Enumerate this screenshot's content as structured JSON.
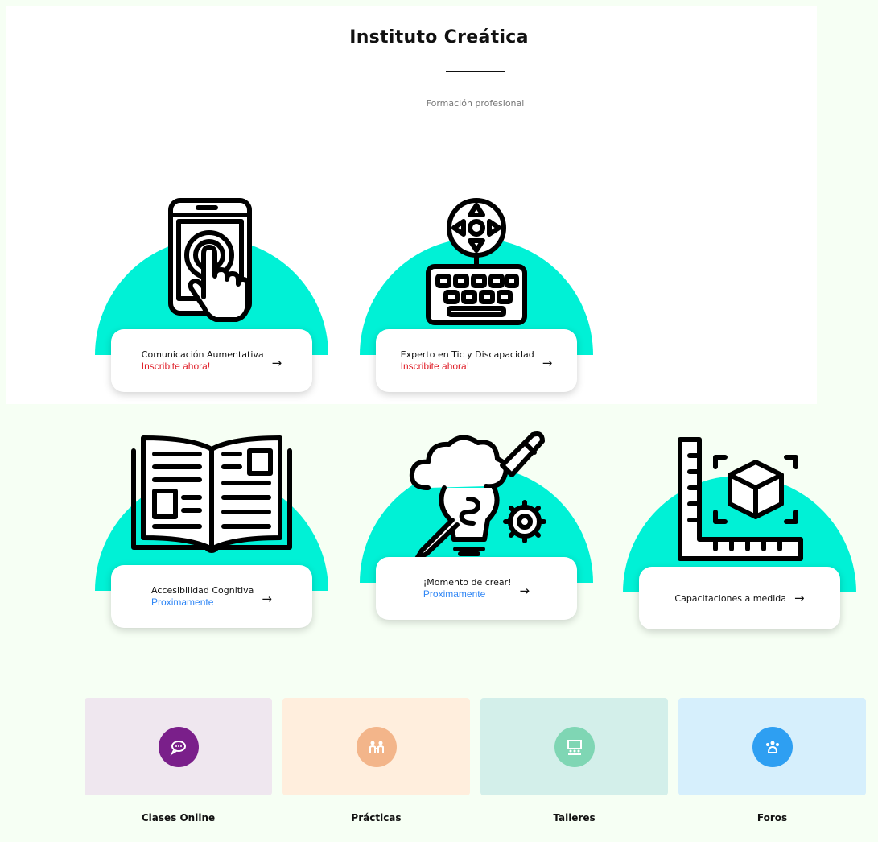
{
  "header": {
    "title": "Instituto Creática",
    "subtitle": "Formación profesional"
  },
  "courses": [
    {
      "name": "Comunicación Aumentativa",
      "status": "Inscribite ahora!",
      "arrow": "→",
      "icon": "tablet-touch-icon"
    },
    {
      "name": "Experto en Tic y Discapacidad",
      "status": "Inscribite ahora!",
      "arrow": "→",
      "icon": "keyboard-gamepad-icon"
    },
    {
      "name": "Accesibilidad Cognitiva",
      "status": "Proximamente",
      "arrow": "→",
      "icon": "open-book-icon"
    },
    {
      "name": "¡Momento de crear!",
      "status": "Proximamente",
      "arrow": "→",
      "icon": "creative-bulb-icon"
    },
    {
      "name": "Capacitaciones a medida",
      "status": "",
      "arrow": "→",
      "icon": "ruler-cube-icon"
    }
  ],
  "features": [
    {
      "label": "Clases Online",
      "icon": "chat-bubble-icon",
      "box_color": "#efe7ef",
      "circle_color": "#7a1f8a"
    },
    {
      "label": "Prácticas",
      "icon": "people-icon",
      "box_color": "#ffeedd",
      "circle_color": "#f3b58a"
    },
    {
      "label": "Talleres",
      "icon": "presentation-icon",
      "box_color": "#d3efea",
      "circle_color": "#7fd6b4"
    },
    {
      "label": "Foros",
      "icon": "group-icon",
      "box_color": "#d6effc",
      "circle_color": "#2e9ff2"
    }
  ],
  "colors": {
    "accent": "#00f1d6",
    "status_enroll": "#e0212b",
    "status_soon": "#2f86f5"
  }
}
